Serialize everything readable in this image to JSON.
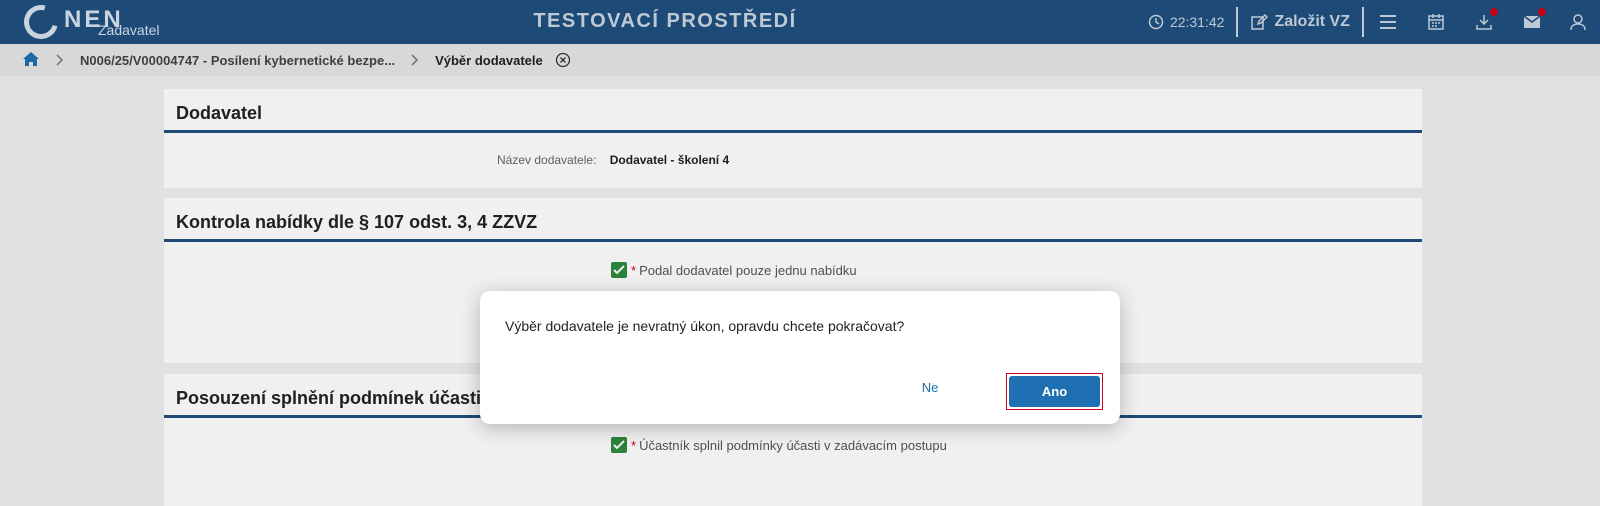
{
  "header": {
    "logo_text": "NEN",
    "logo_sub": "Zadavatel",
    "env_title": "TESTOVACÍ PROSTŘEDÍ",
    "clock": "22:31:42",
    "create_label": "Založit VZ"
  },
  "breadcrumb": {
    "item1": "N006/25/V00004747 - Posílení kybernetické bezpe...",
    "current": "Výběr dodavatele"
  },
  "panels": {
    "supplier": {
      "title": "Dodavatel",
      "name_label": "Název dodavatele:",
      "name_value": "Dodavatel - školení 4"
    },
    "control": {
      "title": "Kontrola nabídky dle § 107 odst. 3, 4 ZZVZ",
      "check_label": "Podal dodavatel pouze jednu nabídku"
    },
    "conditions": {
      "title": "Posouzení splnění podmínek účasti v Z",
      "check_label": "Účastník splnil podmínky účasti v zadávacím postupu"
    }
  },
  "dialog": {
    "message": "Výběr dodavatele je nevratný úkon, opravdu chcete pokračovat?",
    "no_label": "Ne",
    "yes_label": "Ano"
  },
  "colors": {
    "header_bg": "#1f4f7e",
    "accent": "#1f6fb3",
    "check": "#2e8b3e",
    "required": "#d0021b"
  }
}
